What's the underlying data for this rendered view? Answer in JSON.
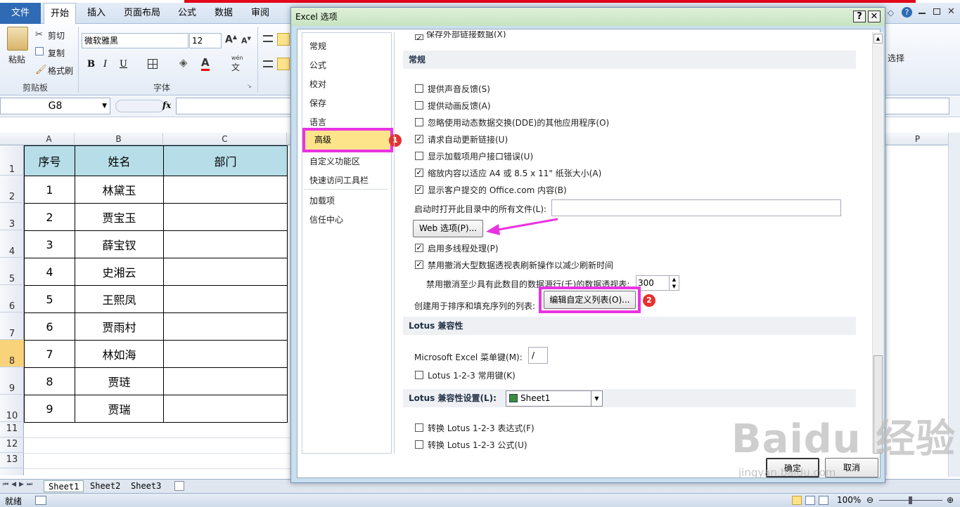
{
  "ribbon": {
    "tabs": [
      "文件",
      "开始",
      "插入",
      "页面布局",
      "公式",
      "数据",
      "审阅"
    ],
    "paste_label": "粘贴",
    "cut_label": "剪切",
    "copy_label": "复制",
    "format_painter_label": "格式刷",
    "clipboard_group": "剪贴板",
    "font_group": "字体",
    "font_name": "微软雅黑",
    "font_size": "12",
    "bold": "B",
    "italic": "I",
    "underline": "U",
    "select_label": "选择",
    "wen_label": "wén",
    "wen_char": "文"
  },
  "formula_bar": {
    "name_box": "G8",
    "fx": "fx"
  },
  "grid": {
    "columns": [
      "A",
      "B",
      "C"
    ],
    "far_column": "P",
    "rows": [
      "1",
      "2",
      "3",
      "4",
      "5",
      "6",
      "7",
      "8",
      "9",
      "10",
      "11",
      "12",
      "13"
    ],
    "header": [
      "序号",
      "姓名",
      "部门"
    ],
    "data": [
      [
        "1",
        "林黛玉",
        ""
      ],
      [
        "2",
        "贾宝玉",
        ""
      ],
      [
        "3",
        "薛宝钗",
        ""
      ],
      [
        "4",
        "史湘云",
        ""
      ],
      [
        "5",
        "王熙凤",
        ""
      ],
      [
        "6",
        "贾雨村",
        ""
      ],
      [
        "7",
        "林如海",
        ""
      ],
      [
        "8",
        "贾琏",
        ""
      ],
      [
        "9",
        "贾瑞",
        ""
      ]
    ]
  },
  "sheets": [
    "Sheet1",
    "Sheet2",
    "Sheet3"
  ],
  "status": {
    "ready": "就绪",
    "zoom": "100%"
  },
  "dialog": {
    "title": "Excel 选项",
    "help": "?",
    "close": "✕",
    "nav": [
      "常规",
      "公式",
      "校对",
      "保存",
      "语言",
      "高级",
      "自定义功能区",
      "快速访问工具栏",
      "加载项",
      "信任中心"
    ],
    "top_cut_option": "保存外部链接数据(X)",
    "section_general": "常规",
    "options_general": [
      {
        "label": "提供声音反馈(S)",
        "checked": false
      },
      {
        "label": "提供动画反馈(A)",
        "checked": false
      },
      {
        "label": "忽略使用动态数据交换(DDE)的其他应用程序(O)",
        "checked": false
      },
      {
        "label": "请求自动更新链接(U)",
        "checked": true
      },
      {
        "label": "显示加载项用户接口错误(U)",
        "checked": false
      },
      {
        "label": "缩放内容以适应 A4 或 8.5 x 11\" 纸张大小(A)",
        "checked": true
      },
      {
        "label": "显示客户提交的 Office.com 内容(B)",
        "checked": true
      }
    ],
    "startup_label": "启动时打开此目录中的所有文件(L):",
    "web_options_btn": "Web 选项(P)...",
    "multithread_label": "启用多线程处理(P)",
    "multithread_checked": true,
    "pivot_label": "禁用撤消大型数据透视表刷新操作以减少刷新时间",
    "pivot_checked": true,
    "pivot_rows_label": "禁用撤消至少具有此数目的数据源行(千)的数据透视表:",
    "pivot_rows_value": "300",
    "custom_list_label": "创建用于排序和填充序列的列表:",
    "custom_list_btn": "编辑自定义列表(O)...",
    "section_lotus": "Lotus 兼容性",
    "menu_key_label": "Microsoft Excel 菜单键(M):",
    "menu_key_value": "/",
    "lotus_nav_label": "Lotus 1-2-3 常用键(K)",
    "section_lotus_settings": "Lotus 兼容性设置(L):",
    "sheet_select": "Sheet1",
    "lotus_expr_label": "转换 Lotus 1-2-3 表达式(F)",
    "lotus_formula_label": "转换 Lotus 1-2-3 公式(U)",
    "ok_btn": "确定",
    "cancel_btn": "取消",
    "badge1": "1",
    "badge2": "2"
  },
  "watermark": {
    "logo": "Baidu 经验",
    "url": "jingyan.baidu.com"
  },
  "colors": {
    "highlight_border": "#e933e2",
    "header_fill": "#b7dee8",
    "badge": "#e5312f",
    "file_tab": "#2f6bb4"
  }
}
